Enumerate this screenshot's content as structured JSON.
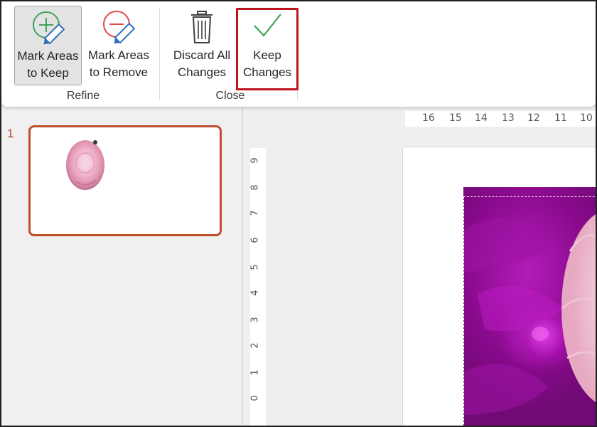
{
  "ribbon": {
    "buttons": {
      "mark_keep": {
        "line1": "Mark Areas",
        "line2": "to Keep"
      },
      "mark_remove": {
        "line1": "Mark Areas",
        "line2": "to Remove"
      },
      "discard": {
        "line1": "Discard All",
        "line2": "Changes"
      },
      "keep_changes": {
        "line1": "Keep",
        "line2": "Changes"
      }
    },
    "groups": {
      "refine": "Refine",
      "close": "Close"
    }
  },
  "thumbnails": {
    "slide_number": "1"
  },
  "rulers": {
    "horizontal": [
      "16",
      "15",
      "14",
      "13",
      "12",
      "11",
      "10"
    ],
    "vertical": [
      "9",
      "8",
      "7",
      "6",
      "5",
      "4",
      "3",
      "2",
      "1",
      "0"
    ]
  },
  "colors": {
    "highlight": "#c0141c",
    "thumb_border": "#c04f2c",
    "photo_background": "#8a0a8e",
    "keep_icon": "#3fa35c",
    "remove_icon": "#e0484b"
  }
}
